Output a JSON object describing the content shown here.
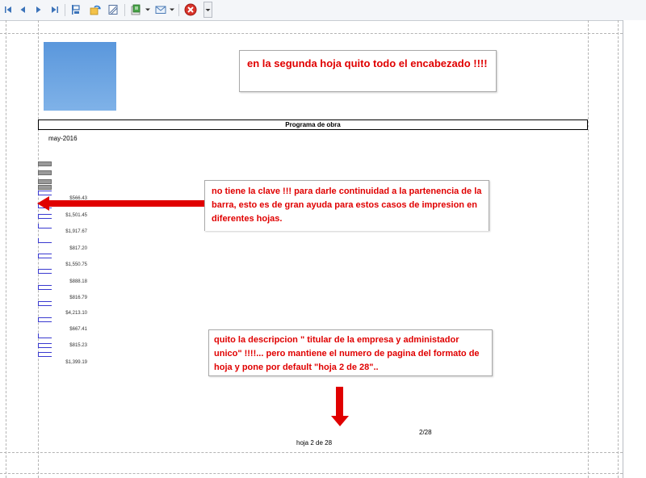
{
  "colors": {
    "accent_red": "#e00000",
    "bracket_blue": "#3a3ad0"
  },
  "toolbar": {
    "buttons": [
      {
        "name": "first-page-icon"
      },
      {
        "name": "previous-page-icon"
      },
      {
        "name": "next-page-icon"
      },
      {
        "name": "last-page-icon"
      },
      {
        "name": "document-map-icon"
      },
      {
        "name": "refresh-icon"
      },
      {
        "name": "page-setup-icon"
      },
      {
        "name": "export-icon"
      },
      {
        "name": "email-icon"
      },
      {
        "name": "close-icon"
      }
    ]
  },
  "report": {
    "title": "Programa de obra",
    "date": "may-2016",
    "page_number": "2/28",
    "footer": "hoja 2 de 28",
    "amounts": [
      "$566.43",
      "$1,501.45",
      "$1,917.67",
      "$817.20",
      "$1,550.75",
      "$888.18",
      "$816.79",
      "$4,213.10",
      "$667.41",
      "$815.23",
      "$1,399.19"
    ]
  },
  "callouts": {
    "top": "en la segunda hoja  quito todo el encabezado !!!!",
    "middle": "no tiene la clave !!! para darle continuidad a la partenencia de la barra, esto es de gran ayuda para estos casos de impresion en diferentes hojas.",
    "bottom": "quito la descripcion \" titular de la empresa y administador unico\"  !!!!... pero mantiene el numero de pagina del formato de hoja y pone por default \"hoja 2 de 28\".."
  }
}
